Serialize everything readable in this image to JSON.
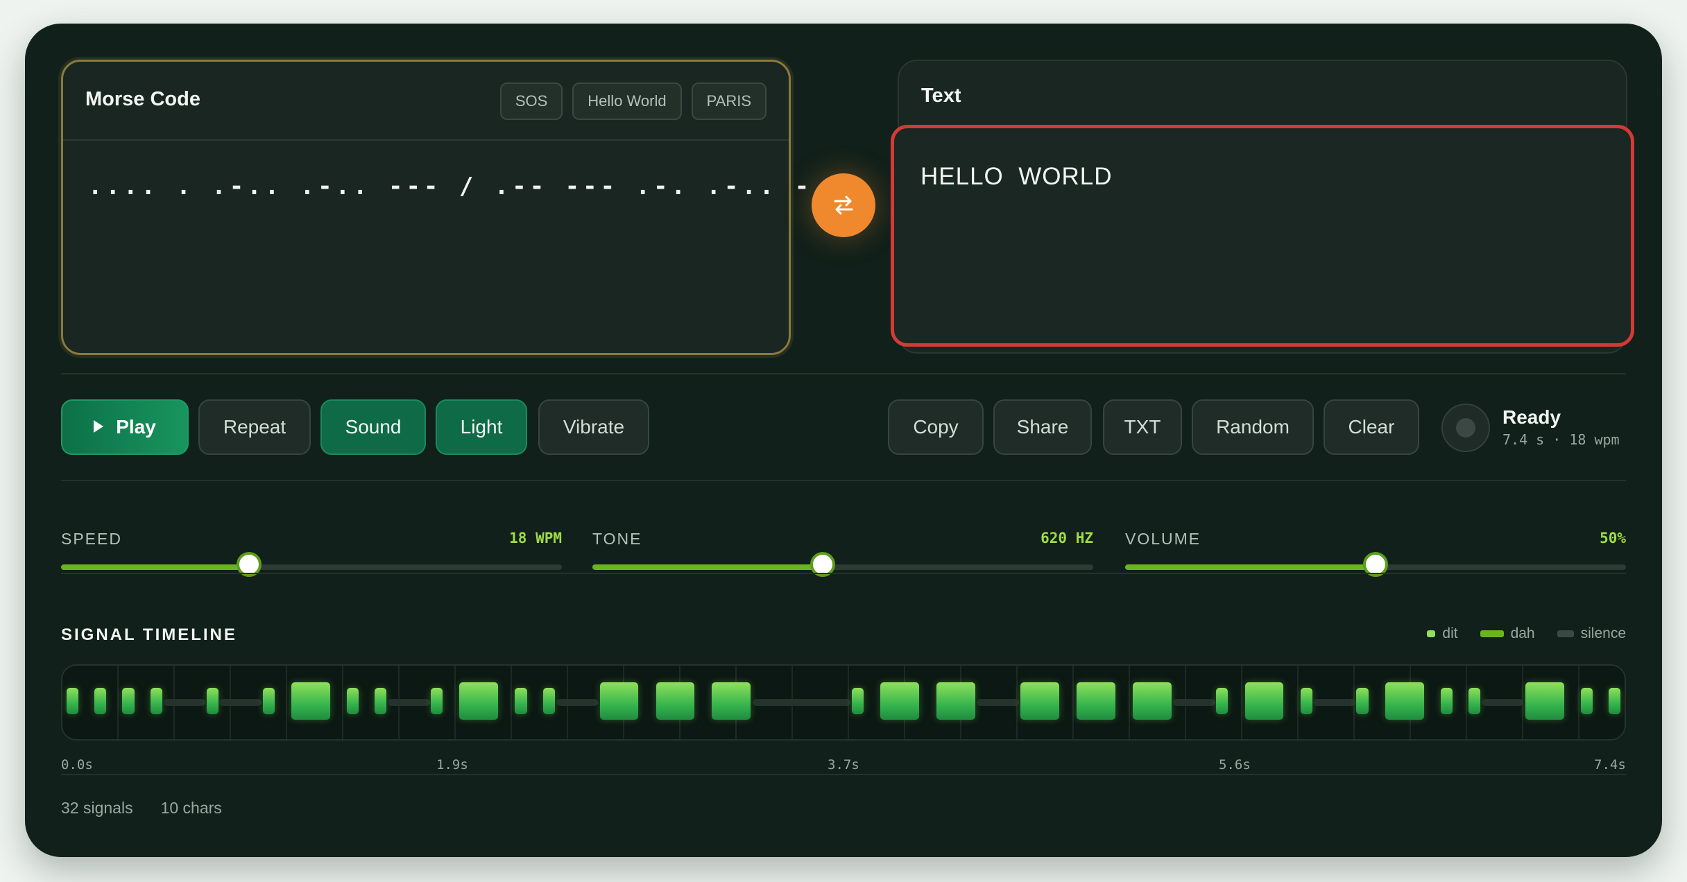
{
  "morse_panel": {
    "title": "Morse Code",
    "presets": [
      "SOS",
      "Hello World",
      "PARIS"
    ],
    "value": ".... . .-.. .-.. --- / .-- --- .-. .-.. -.."
  },
  "text_panel": {
    "title": "Text",
    "value": "HELLO  WORLD"
  },
  "controls": {
    "play": "Play",
    "repeat": "Repeat",
    "sound": "Sound",
    "light": "Light",
    "vibrate": "Vibrate",
    "copy": "Copy",
    "share": "Share",
    "txt": "TXT",
    "random": "Random",
    "clear": "Clear"
  },
  "status": {
    "title": "Ready",
    "sub": "7.4 s · 18 wpm"
  },
  "sliders": [
    {
      "label": "SPEED",
      "value": "18 WPM",
      "fraction": 0.375
    },
    {
      "label": "TONE",
      "value": "620 HZ",
      "fraction": 0.46
    },
    {
      "label": "VOLUME",
      "value": "50%",
      "fraction": 0.5
    }
  ],
  "timeline": {
    "title": "SIGNAL TIMELINE",
    "legend": [
      {
        "label": "dit",
        "color": "#8fe05a"
      },
      {
        "label": "dah",
        "color": "#6ab41e"
      },
      {
        "label": "silence",
        "color": "#3b4843"
      }
    ],
    "signals": ".... . .-.. .-.. --- / .-- --- .-. .-.. -..",
    "ticks": [
      "0.0s",
      "1.9s",
      "3.7s",
      "5.6s",
      "7.4s"
    ]
  },
  "footer": {
    "signals": "32 signals",
    "chars": "10 chars"
  },
  "colors": {
    "accent": "#0f6a47",
    "swap": "#f0892e",
    "highlight": "#d43a34",
    "slider": "#6ab41e"
  }
}
